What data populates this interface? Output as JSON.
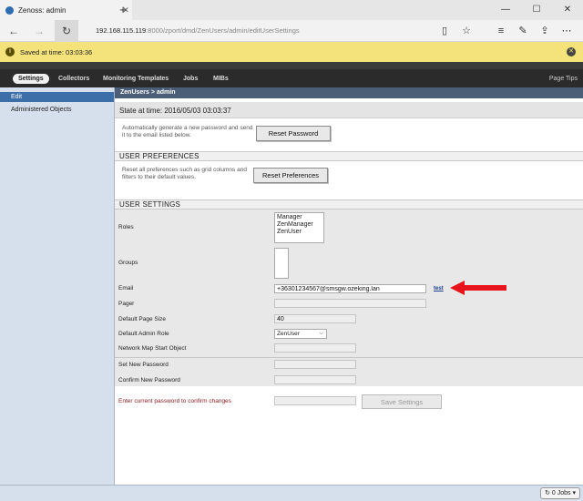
{
  "browser": {
    "tab_title": "Zenoss: admin",
    "url_host": "192.168.115.119",
    "url_path": ":8000/zport/dmd/ZenUsers/admin/editUserSettings"
  },
  "saved_bar": {
    "message": "Saved at time: 03:03:36"
  },
  "app_nav": {
    "items": [
      "Settings",
      "Collectors",
      "Monitoring Templates",
      "Jobs",
      "MIBs"
    ],
    "page_tips": "Page Tips"
  },
  "sidebar": {
    "items": [
      "Edit",
      "Administered Objects"
    ]
  },
  "breadcrumb": "ZenUsers > admin",
  "state_time": "State at time: 2016/05/03 03:03:37",
  "reset_password": {
    "description": "Automatically generate a new password and send it to the email listed below.",
    "button": "Reset Password"
  },
  "user_preferences": {
    "title": "USER PREFERENCES",
    "description": "Reset all preferences such as grid columns and filters to their default values.",
    "button": "Reset Preferences"
  },
  "user_settings": {
    "title": "USER SETTINGS",
    "roles_label": "Roles",
    "roles": [
      "Manager",
      "ZenManager",
      "ZenUser"
    ],
    "groups_label": "Groups",
    "email_label": "Email",
    "email_value": "+36301234567@smsgw.ozeking.lan",
    "test_link": "test",
    "pager_label": "Pager",
    "pager_value": "",
    "page_size_label": "Default Page Size",
    "page_size_value": "40",
    "admin_role_label": "Default Admin Role",
    "admin_role_value": "ZenUser",
    "network_map_label": "Network Map Start Object",
    "network_map_value": "",
    "new_password_label": "Set New Password",
    "confirm_password_label": "Confirm New Password",
    "current_password_label": "Enter current password to confirm changes",
    "save_button": "Save Settings"
  },
  "statusbar": {
    "jobs": "0 Jobs"
  },
  "colors": {
    "accent_arrow": "#e8141b",
    "sidebar_bg": "#d6e0ec",
    "saved_bar": "#f4e27a"
  }
}
